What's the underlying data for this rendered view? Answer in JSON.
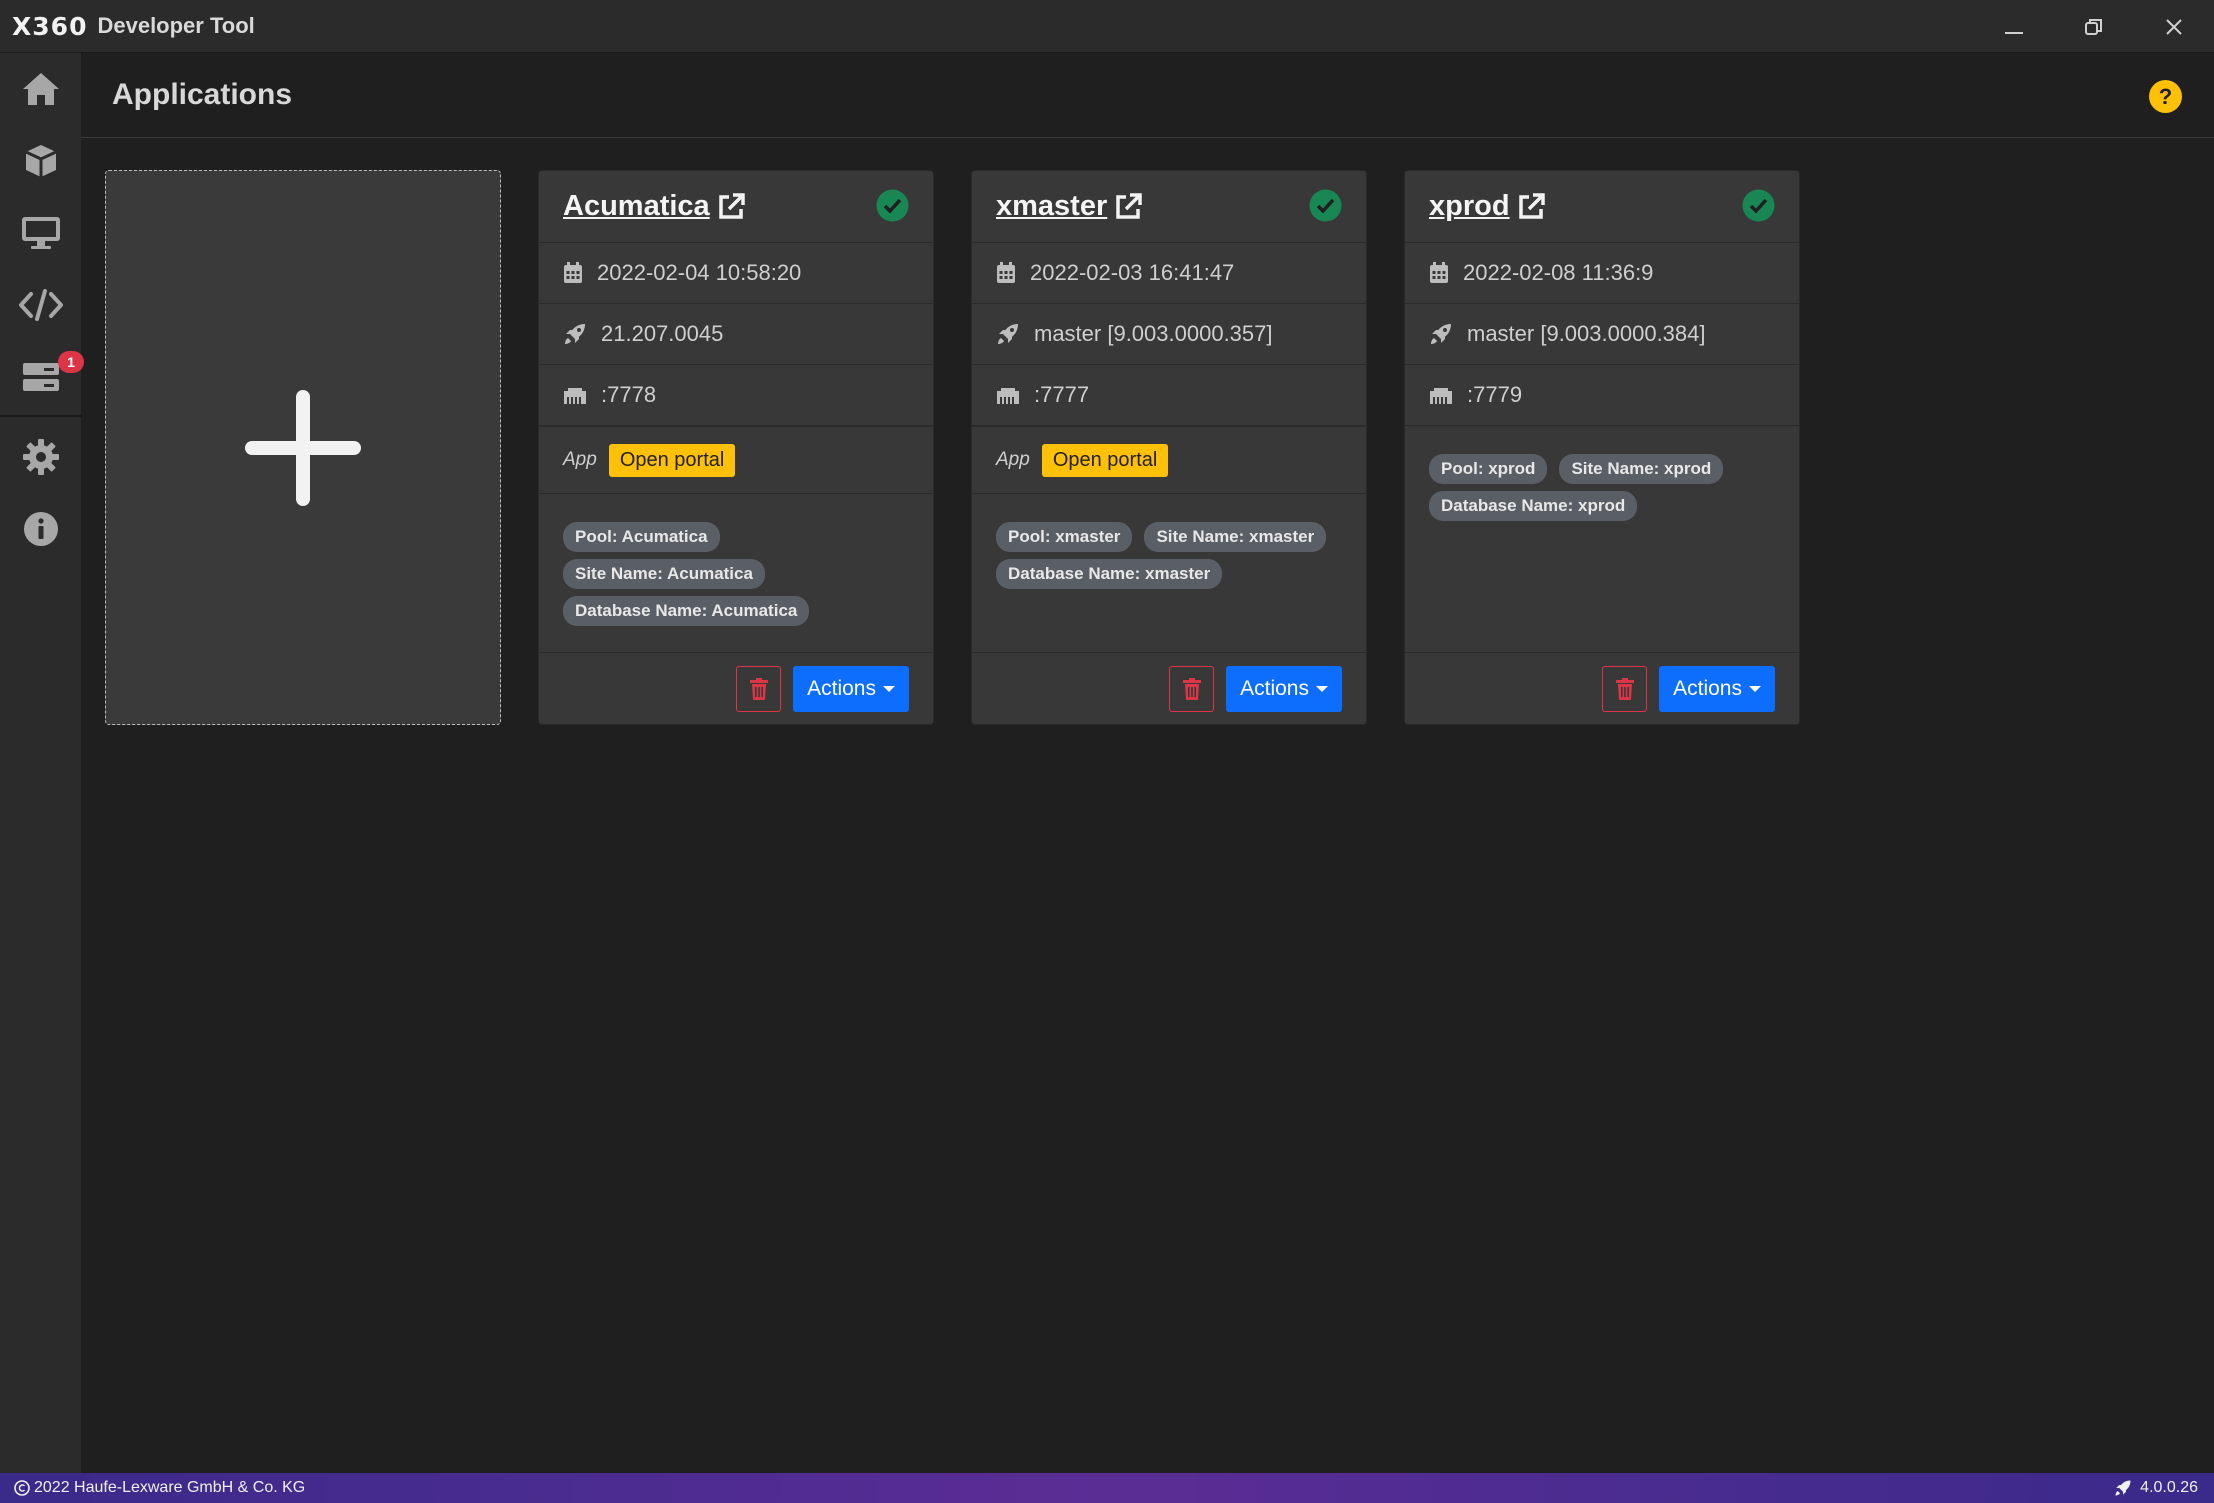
{
  "titlebar": {
    "logo": "X360",
    "app_name": "Developer Tool"
  },
  "header": {
    "title": "Applications"
  },
  "sidebar": {
    "items": [
      {
        "name": "home",
        "icon": "home-icon"
      },
      {
        "name": "packages",
        "icon": "cube-icon"
      },
      {
        "name": "monitor",
        "icon": "desktop-icon"
      },
      {
        "name": "code",
        "icon": "code-icon"
      },
      {
        "name": "servers",
        "icon": "server-icon",
        "badge": "1"
      },
      {
        "name": "settings",
        "icon": "gear-icon"
      },
      {
        "name": "info",
        "icon": "info-icon"
      }
    ]
  },
  "apps": [
    {
      "title": "Acumatica",
      "date": "2022-02-04 10:58:20",
      "version": "21.207.0045",
      "port": ":7778",
      "app_label": "App",
      "portal_label": "Open portal",
      "tags": [
        "Pool: Acumatica",
        "Site Name: Acumatica",
        "Database Name: Acumatica"
      ],
      "actions_label": "Actions"
    },
    {
      "title": "xmaster",
      "date": "2022-02-03 16:41:47",
      "version": "master [9.003.0000.357]",
      "port": ":7777",
      "app_label": "App",
      "portal_label": "Open portal",
      "tags": [
        "Pool: xmaster",
        "Site Name: xmaster",
        "Database Name: xmaster"
      ],
      "actions_label": "Actions"
    },
    {
      "title": "xprod",
      "date": "2022-02-08 11:36:9",
      "version": "master [9.003.0000.384]",
      "port": ":7779",
      "tags": [
        "Pool: xprod",
        "Site Name: xprod",
        "Database Name: xprod"
      ],
      "actions_label": "Actions"
    }
  ],
  "statusbar": {
    "copyright": "2022 Haufe-Lexware GmbH & Co. KG",
    "version": "4.0.0.26"
  },
  "colors": {
    "accent_blue": "#0d6efd",
    "warning": "#ffc107",
    "success": "#198754",
    "danger": "#dc3545"
  }
}
